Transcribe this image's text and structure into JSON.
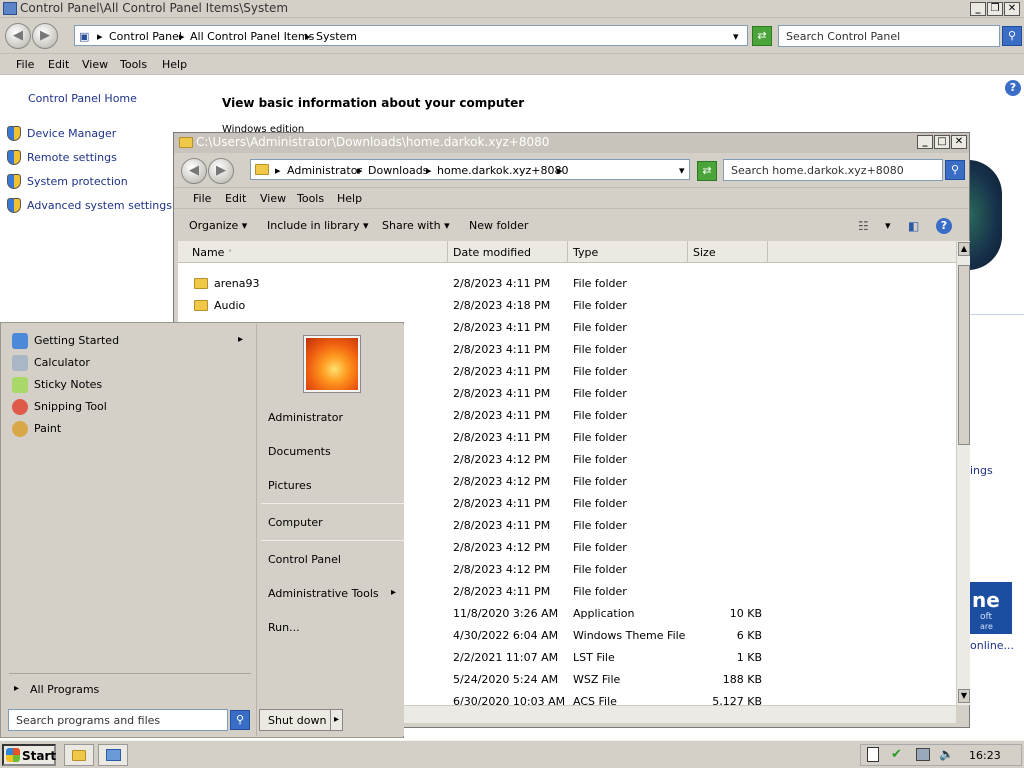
{
  "control_panel": {
    "title": "Control Panel\\All Control Panel Items\\System",
    "breadcrumbs": [
      "Control Panel",
      "All Control Panel Items",
      "System"
    ],
    "search_placeholder": "Search Control Panel",
    "menu": [
      "File",
      "Edit",
      "View",
      "Tools",
      "Help"
    ],
    "home_link": "Control Panel Home",
    "side_links": [
      "Device Manager",
      "Remote settings",
      "System protection",
      "Advanced system settings"
    ],
    "heading": "View basic information about your computer",
    "subheading": "Windows edition",
    "right_fragments": {
      "settings": "ings",
      "online": "online...",
      "brand": "ne",
      "brand2": "oft",
      "brand3": "are"
    }
  },
  "explorer": {
    "title": "C:\\Users\\Administrator\\Downloads\\home.darkok.xyz+8080",
    "breadcrumbs": [
      "Administrator",
      "Downloads",
      "home.darkok.xyz+8080"
    ],
    "search_placeholder": "Search home.darkok.xyz+8080",
    "menu": [
      "File",
      "Edit",
      "View",
      "Tools",
      "Help"
    ],
    "commands": {
      "organize": "Organize",
      "include": "Include in library",
      "share": "Share with",
      "new_folder": "New folder"
    },
    "columns": [
      "Name",
      "Date modified",
      "Type",
      "Size"
    ],
    "rows": [
      {
        "name": "arena93",
        "date": "2/8/2023 4:11 PM",
        "type": "File folder",
        "size": ""
      },
      {
        "name": "Audio",
        "date": "2/8/2023 4:18 PM",
        "type": "File folder",
        "size": ""
      },
      {
        "name": "",
        "date": "2/8/2023 4:11 PM",
        "type": "File folder",
        "size": ""
      },
      {
        "name": "",
        "date": "2/8/2023 4:11 PM",
        "type": "File folder",
        "size": ""
      },
      {
        "name": "",
        "date": "2/8/2023 4:11 PM",
        "type": "File folder",
        "size": ""
      },
      {
        "name": "",
        "date": "2/8/2023 4:11 PM",
        "type": "File folder",
        "size": ""
      },
      {
        "name": "",
        "date": "2/8/2023 4:11 PM",
        "type": "File folder",
        "size": ""
      },
      {
        "name": "",
        "date": "2/8/2023 4:11 PM",
        "type": "File folder",
        "size": ""
      },
      {
        "name": "",
        "date": "2/8/2023 4:12 PM",
        "type": "File folder",
        "size": ""
      },
      {
        "name": "",
        "date": "2/8/2023 4:12 PM",
        "type": "File folder",
        "size": ""
      },
      {
        "name": "",
        "date": "2/8/2023 4:11 PM",
        "type": "File folder",
        "size": ""
      },
      {
        "name": "",
        "date": "2/8/2023 4:11 PM",
        "type": "File folder",
        "size": ""
      },
      {
        "name": "",
        "date": "2/8/2023 4:12 PM",
        "type": "File folder",
        "size": ""
      },
      {
        "name": "",
        "date": "2/8/2023 4:12 PM",
        "type": "File folder",
        "size": ""
      },
      {
        "name": "",
        "date": "2/8/2023 4:11 PM",
        "type": "File folder",
        "size": ""
      },
      {
        "name": "",
        "date": "11/8/2020 3:26 AM",
        "type": "Application",
        "size": "10 KB"
      },
      {
        "name": "",
        "date": "4/30/2022 6:04 AM",
        "type": "Windows Theme File",
        "size": "6 KB"
      },
      {
        "name": "",
        "date": "2/2/2021 11:07 AM",
        "type": "LST File",
        "size": "1 KB"
      },
      {
        "name": "",
        "date": "5/24/2020 5:24 AM",
        "type": "WSZ File",
        "size": "188 KB"
      },
      {
        "name": "",
        "date": "6/30/2020 10:03 AM",
        "type": "ACS File",
        "size": "5,127 KB"
      }
    ]
  },
  "start_menu": {
    "left_items": [
      "Getting Started",
      "Calculator",
      "Sticky Notes",
      "Snipping Tool",
      "Paint"
    ],
    "all_programs": "All Programs",
    "search_placeholder": "Search programs and files",
    "right_items": [
      "Administrator",
      "Documents",
      "Pictures",
      "Computer",
      "Control Panel",
      "Administrative Tools",
      "Run..."
    ],
    "shutdown": "Shut down"
  },
  "taskbar": {
    "start": "Start",
    "clock": "16:23"
  }
}
